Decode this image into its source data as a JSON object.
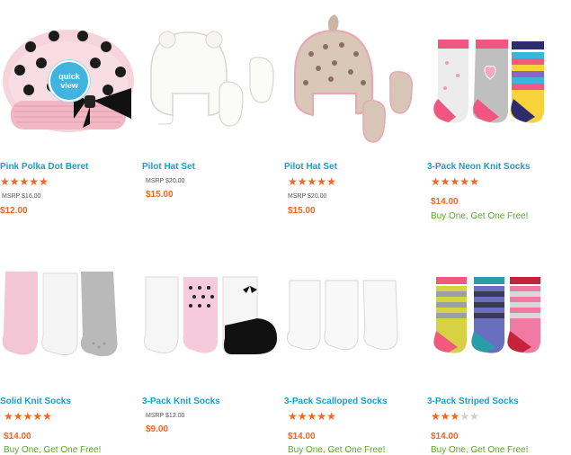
{
  "colors": {
    "link": "#1a9dc9",
    "price": "#f26522",
    "promo": "#5aa629",
    "star_on": "#f26522",
    "star_off": "#d0d0d0"
  },
  "quick_view": {
    "line1": "quick",
    "line2": "view"
  },
  "products": [
    {
      "name": "Pink Polka Dot Beret",
      "rating": 5,
      "msrp": "MSRP $16.00",
      "price": "$12.00",
      "promo": "",
      "image": "pink-polka-dot-beret"
    },
    {
      "name": "Pilot Hat Set",
      "rating": null,
      "msrp": "MSRP $20.00",
      "price": "$15.00",
      "promo": "",
      "image": "white-pilot-hat-set"
    },
    {
      "name": "Pilot Hat Set",
      "rating": 5,
      "msrp": "MSRP $20.00",
      "price": "$15.00",
      "promo": "",
      "image": "leopard-pilot-hat-set"
    },
    {
      "name": "3-Pack Neon Knit Socks",
      "rating": 5,
      "msrp": "",
      "price": "$14.00",
      "promo": "Buy One, Get One Free!",
      "image": "neon-knit-socks"
    },
    {
      "name": "Solid Knit Socks",
      "rating": 5,
      "msrp": "",
      "price": "$14.00",
      "promo": "Buy One, Get One Free!",
      "image": "solid-knit-socks"
    },
    {
      "name": "3-Pack Knit Socks",
      "rating": null,
      "msrp": "MSRP $12.00",
      "price": "$9.00",
      "promo": "",
      "image": "knit-socks"
    },
    {
      "name": "3-Pack Scalloped Socks",
      "rating": 5,
      "msrp": "",
      "price": "$14.00",
      "promo": "Buy One, Get One Free!",
      "image": "scalloped-socks"
    },
    {
      "name": "3-Pack Striped Socks",
      "rating": 3,
      "msrp": "",
      "price": "$14.00",
      "promo": "Buy One, Get One Free!",
      "image": "striped-socks"
    }
  ]
}
